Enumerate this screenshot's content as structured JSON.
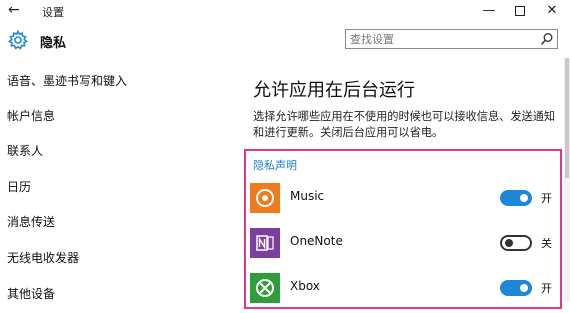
{
  "window": {
    "back_glyph": "←",
    "title": "设置",
    "minimize_glyph": "—",
    "close_glyph": "✕"
  },
  "header": {
    "page_title": "隐私",
    "gear_icon": "gear-icon"
  },
  "search": {
    "placeholder": "查找设置",
    "icon": "search-icon"
  },
  "sidebar": {
    "items": [
      {
        "label": "语音、墨迹书写和键入"
      },
      {
        "label": "帐户信息"
      },
      {
        "label": "联系人"
      },
      {
        "label": "日历"
      },
      {
        "label": "消息传送"
      },
      {
        "label": "无线电收发器"
      },
      {
        "label": "其他设备"
      }
    ]
  },
  "main": {
    "title": "允许应用在后台运行",
    "description": "选择允许哪些应用在不使用的时候也可以接收信息、发送通知和进行更新。关闭后台应用可以省电。",
    "privacy_link": "隐私声明",
    "apps": [
      {
        "name": "Music",
        "state": "on",
        "state_label": "开",
        "tile_color": "#ef7b1e",
        "icon": "music-icon"
      },
      {
        "name": "OneNote",
        "state": "off",
        "state_label": "关",
        "tile_color": "#7b3fa0",
        "icon": "onenote-icon"
      },
      {
        "name": "Xbox",
        "state": "on",
        "state_label": "开",
        "tile_color": "#2f9e3a",
        "icon": "xbox-icon"
      }
    ]
  },
  "colors": {
    "accent": "#1e88d6",
    "link": "#1e7bd3",
    "highlight_border": "#e0398a"
  }
}
